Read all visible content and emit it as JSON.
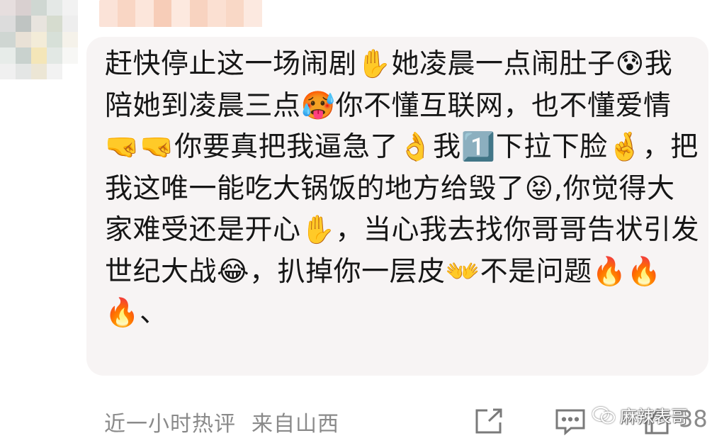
{
  "comment": {
    "text": "赶快停止这一场闹剧✋她凌晨一点闹肚子😰我陪她到凌晨三点🥵你不懂互联网，也不懂爱情🤜🤜你要真把我逼急了👌我1️⃣下拉下脸🤞，把我这唯一能吃大锅饭的地方给毁了😝,你觉得大家难受还是开心✋，当心我去找你哥哥告状引发世纪大战😂，扒掉你一层皮👐不是问题🔥🔥🔥、"
  },
  "footer": {
    "time": "近一小时热评",
    "location": "来自山西",
    "watermark": "麻辣表哥",
    "like_count": "38"
  },
  "icons": {
    "share": "share-icon",
    "reply": "comment-icon",
    "like": "like-icon"
  },
  "colors": {
    "bubble": "#f7f4f4",
    "text": "#161616",
    "meta": "#8a8a8a"
  }
}
